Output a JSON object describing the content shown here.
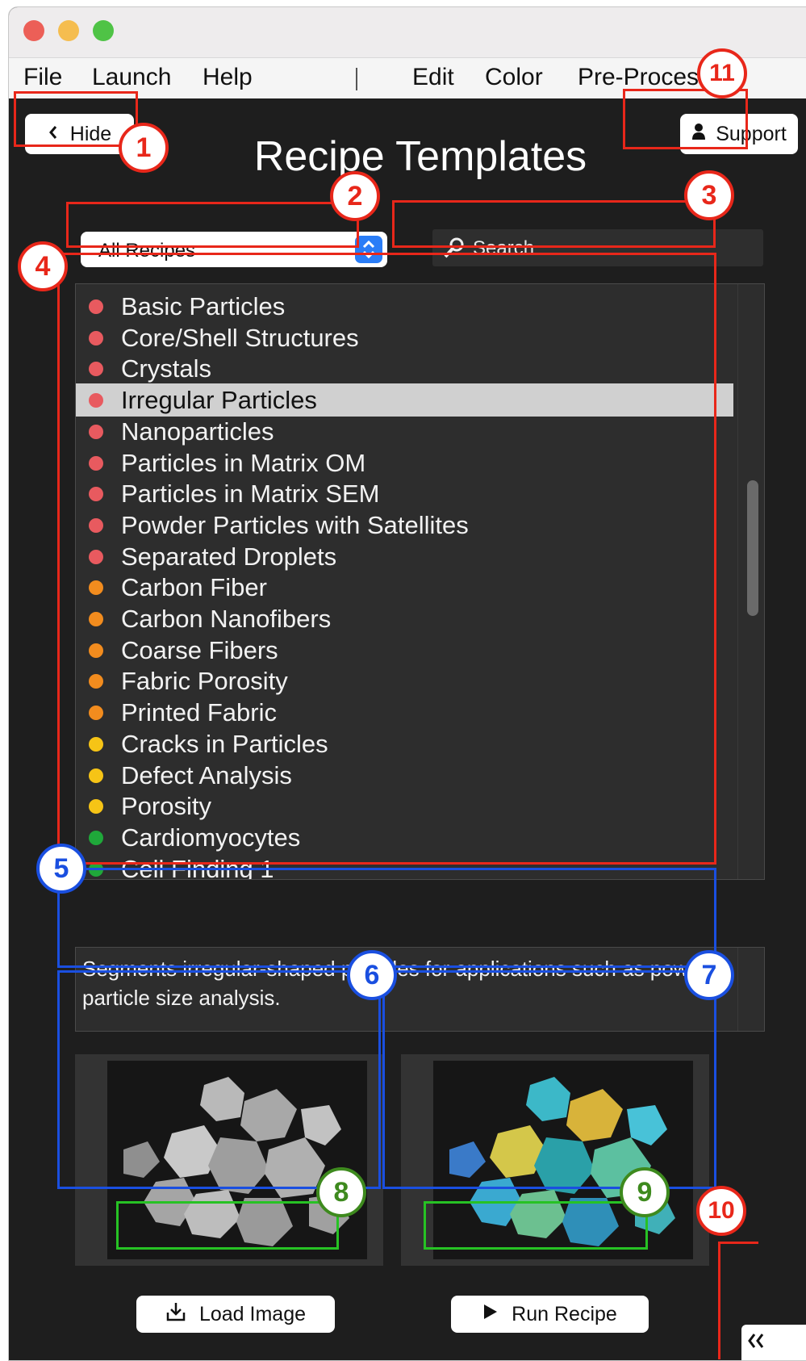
{
  "menubar": {
    "items": [
      "File",
      "Launch",
      "Help",
      "Edit",
      "Color",
      "Pre-Proces"
    ]
  },
  "header": {
    "hide_label": "Hide",
    "support_label": "Support",
    "title": "Recipe Templates"
  },
  "filters": {
    "category_value": "All Recipes",
    "search_placeholder": "Search"
  },
  "recipes": [
    {
      "label": "Basic Particles",
      "color": "#e85a5f"
    },
    {
      "label": "Core/Shell Structures",
      "color": "#e85a5f"
    },
    {
      "label": "Crystals",
      "color": "#e85a5f"
    },
    {
      "label": "Irregular Particles",
      "color": "#e85a5f",
      "selected": true
    },
    {
      "label": "Nanoparticles",
      "color": "#e85a5f"
    },
    {
      "label": "Particles in Matrix OM",
      "color": "#e85a5f"
    },
    {
      "label": "Particles in Matrix SEM",
      "color": "#e85a5f"
    },
    {
      "label": "Powder Particles with Satellites",
      "color": "#e85a5f"
    },
    {
      "label": "Separated Droplets",
      "color": "#e85a5f"
    },
    {
      "label": "Carbon Fiber",
      "color": "#f28c1e"
    },
    {
      "label": "Carbon Nanofibers",
      "color": "#f28c1e"
    },
    {
      "label": "Coarse Fibers",
      "color": "#f28c1e"
    },
    {
      "label": "Fabric Porosity",
      "color": "#f28c1e"
    },
    {
      "label": "Printed Fabric",
      "color": "#f28c1e"
    },
    {
      "label": "Cracks in Particles",
      "color": "#f6c416"
    },
    {
      "label": "Defect Analysis",
      "color": "#f6c416"
    },
    {
      "label": "Porosity",
      "color": "#f6c416"
    },
    {
      "label": "Cardiomyocytes",
      "color": "#1fa83a"
    },
    {
      "label": "Cell Finding 1",
      "color": "#1fa83a"
    }
  ],
  "description": "Segments irregular-shaped particles for applications such as powder particle size analysis.",
  "actions": {
    "load_label": "Load Image",
    "run_label": "Run Recipe"
  },
  "annotations": {
    "numbers": [
      "1",
      "2",
      "3",
      "4",
      "5",
      "6",
      "7",
      "8",
      "9",
      "10",
      "11"
    ],
    "colors": {
      "red": "#e8271a",
      "blue": "#1a4fe0",
      "green": "#27c224"
    }
  }
}
